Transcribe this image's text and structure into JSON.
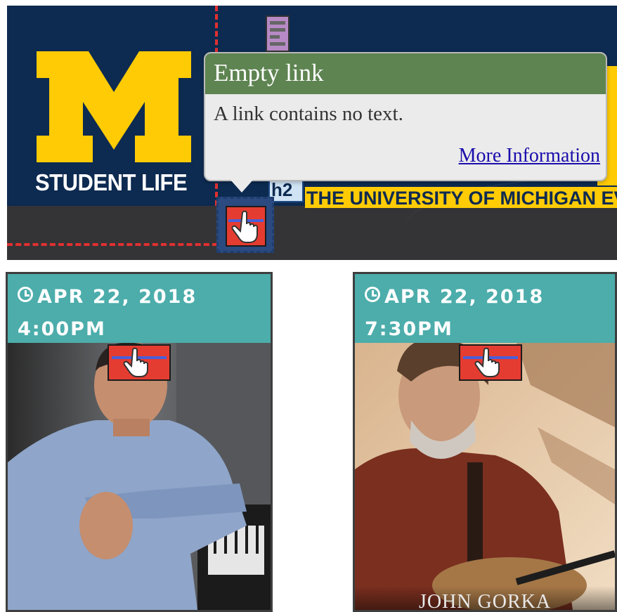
{
  "header": {
    "logo_text": "STUDENT LIFE",
    "heading_badge": "h2",
    "marquee_text": "THE UNIVERSITY OF MICHIGAN EVENTS",
    "colors": {
      "navy": "#0d2a50",
      "maize": "#ffcb05",
      "band": "#343436"
    }
  },
  "tooltip": {
    "title": "Empty link",
    "message": "A link contains no text.",
    "link_label": "More Information",
    "colors": {
      "header": "#5e8451",
      "body": "#ebebeb"
    }
  },
  "events": [
    {
      "date": "APR 22, 2018",
      "time": "4:00PM",
      "caption": ""
    },
    {
      "date": "APR 22, 2018",
      "time": "7:30PM",
      "caption": "JOHN GORKA"
    }
  ],
  "icons": {
    "hand": "hand-pointer-icon",
    "clock": "clock-icon",
    "structure": "structure-icon"
  },
  "colors": {
    "card_header": "#4cadab",
    "error_marker": "#e53c31",
    "outline": "#e03030"
  }
}
